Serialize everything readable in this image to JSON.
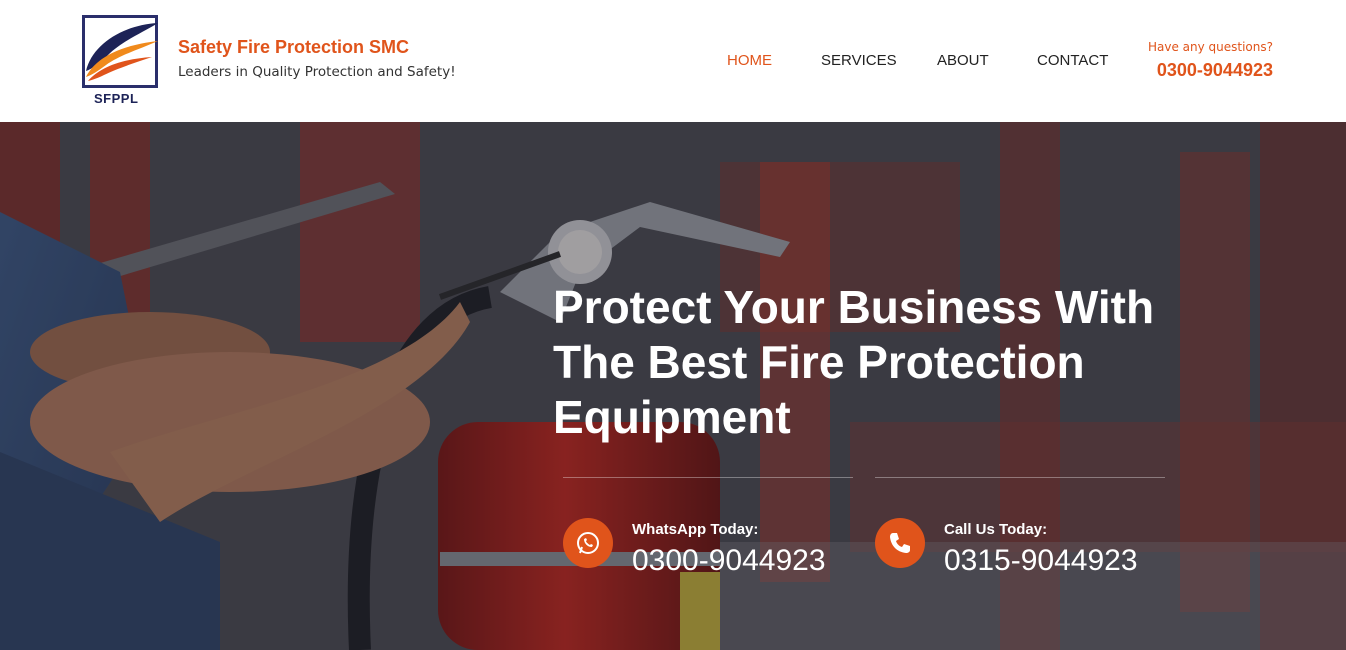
{
  "header": {
    "logo_text": "SFPPL",
    "brand_name": "Safety Fire Protection SMC",
    "tagline": "Leaders in Quality Protection and Safety!",
    "nav": {
      "home": "HOME",
      "services": "SERVICES",
      "about": "ABOUT",
      "contact": "CONTACT"
    },
    "question": "Have any questions?",
    "phone": "0300-9044923"
  },
  "hero": {
    "headline_line1": "Protect Your Business With",
    "headline_line2": "The Best Fire Protection",
    "headline_line3": "Equipment",
    "whatsapp_label": "WhatsApp Today:",
    "whatsapp_number": "0300-9044923",
    "call_label": "Call Us Today:",
    "call_number": "0315-9044923"
  },
  "colors": {
    "accent": "#e0541b",
    "logo_navy": "#2a2f6b"
  },
  "icons": {
    "whatsapp": "whatsapp-icon",
    "phone": "phone-icon"
  }
}
